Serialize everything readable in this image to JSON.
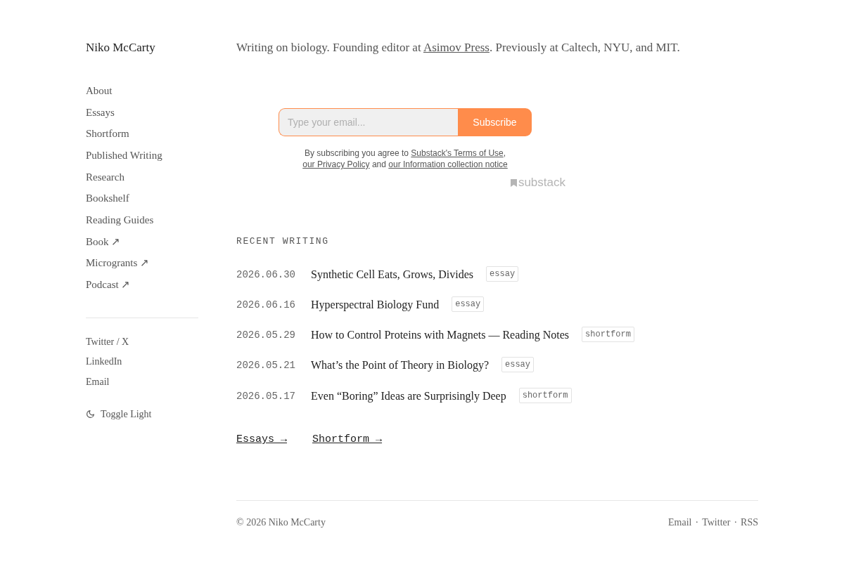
{
  "site": {
    "name": "Niko McCarty"
  },
  "nav": {
    "items": [
      {
        "label": "About"
      },
      {
        "label": "Essays"
      },
      {
        "label": "Shortform"
      },
      {
        "label": "Published Writing"
      },
      {
        "label": "Research"
      },
      {
        "label": "Bookshelf"
      },
      {
        "label": "Reading Guides"
      },
      {
        "label": "Book",
        "arrow": "↗"
      },
      {
        "label": "Microgrants",
        "arrow": "↗"
      },
      {
        "label": "Podcast",
        "arrow": "↗"
      }
    ]
  },
  "social": {
    "items": [
      {
        "label": "Twitter / X"
      },
      {
        "label": "LinkedIn"
      },
      {
        "label": "Email"
      }
    ]
  },
  "theme_toggle": {
    "label": "Toggle Light"
  },
  "intro": {
    "before": "Writing on biology. Founding editor at ",
    "link": "Asimov Press",
    "after": ". Previously at Caltech, NYU, and MIT."
  },
  "subscribe": {
    "placeholder": "Type your email...",
    "button": "Subscribe",
    "consent": [
      {
        "kind": "text",
        "text": "By subscribing you agree to "
      },
      {
        "kind": "link",
        "text": "Substack's Terms of Use"
      },
      {
        "kind": "text",
        "text": ", "
      },
      {
        "kind": "link",
        "text": "our Privacy Policy"
      },
      {
        "kind": "text",
        "text": " and "
      },
      {
        "kind": "link",
        "text": "our Information collection notice"
      }
    ],
    "branding": "substack"
  },
  "recent": {
    "heading": "RECENT WRITING",
    "posts": [
      {
        "date": "2026.06.30",
        "title": "Synthetic Cell Eats, Grows, Divides",
        "tag": "essay"
      },
      {
        "date": "2026.06.16",
        "title": "Hyperspectral Biology Fund",
        "tag": "essay"
      },
      {
        "date": "2026.05.29",
        "title": "How to Control Proteins with Magnets — Reading Notes",
        "tag": "shortform"
      },
      {
        "date": "2026.05.21",
        "title": "What’s the Point of Theory in Biology?",
        "tag": "essay"
      },
      {
        "date": "2026.05.17",
        "title": "Even “Boring” Ideas are Surprisingly Deep",
        "tag": "shortform"
      }
    ],
    "links": [
      {
        "label": "Essays →"
      },
      {
        "label": "Shortform →"
      }
    ]
  },
  "footer": {
    "copyright": "© 2026 Niko McCarty",
    "links": [
      {
        "label": "Email"
      },
      {
        "label": "Twitter"
      },
      {
        "label": "RSS"
      }
    ],
    "separators": [
      "·",
      "·"
    ]
  }
}
